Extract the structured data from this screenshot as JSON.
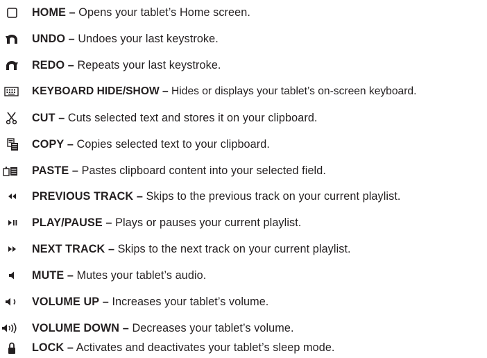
{
  "separator": "–",
  "items": [
    {
      "icon": "home-icon",
      "label": "HOME",
      "description": "Opens your tablet’s Home screen."
    },
    {
      "icon": "undo-icon",
      "label": "UNDO",
      "description": "Undoes your last keystroke."
    },
    {
      "icon": "redo-icon",
      "label": "REDO",
      "description": "Repeats your last keystroke."
    },
    {
      "icon": "keyboard-icon",
      "label": "KEYBOARD HIDE/SHOW",
      "description": "Hides or displays your tablet’s on-screen keyboard."
    },
    {
      "icon": "scissors-icon",
      "label": "CUT",
      "description": "Cuts selected text and stores it on your clipboard."
    },
    {
      "icon": "copy-icon",
      "label": "COPY",
      "description": "Copies selected text to your clipboard."
    },
    {
      "icon": "paste-icon",
      "label": "PASTE",
      "description": "Pastes clipboard content into your selected field."
    },
    {
      "icon": "previous-track-icon",
      "label": "PREVIOUS TRACK",
      "description": "Skips to the previous track on your current playlist."
    },
    {
      "icon": "play-pause-icon",
      "label": "PLAY/PAUSE",
      "description": "Plays or pauses your current playlist."
    },
    {
      "icon": "next-track-icon",
      "label": "NEXT TRACK",
      "description": "Skips to the next track on your current playlist."
    },
    {
      "icon": "mute-icon",
      "label": "MUTE",
      "description": "Mutes your tablet’s audio."
    },
    {
      "icon": "volume-low-icon",
      "label": "VOLUME UP",
      "description": "Increases your tablet’s volume."
    },
    {
      "icon": "volume-high-icon",
      "label": "VOLUME DOWN",
      "description": "Decreases your tablet’s volume."
    },
    {
      "icon": "lock-icon",
      "label": "LOCK",
      "description": "Activates and deactivates your tablet’s sleep mode."
    }
  ]
}
